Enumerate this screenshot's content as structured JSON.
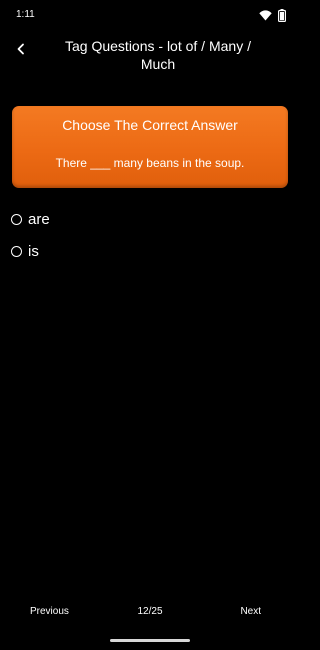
{
  "status_bar": {
    "time": "1:11",
    "icons": [
      "wifi-icon",
      "battery-icon"
    ]
  },
  "app_bar": {
    "back_icon": "chevron-left-icon",
    "title": "Tag Questions - lot of / Many / Much"
  },
  "card": {
    "heading": "Choose The Correct Answer",
    "question": "There ___ many beans in the soup.",
    "color": "#ec6a14"
  },
  "options": [
    {
      "label": "are",
      "selected": false
    },
    {
      "label": "is",
      "selected": false
    }
  ],
  "nav": {
    "previous": "Previous",
    "counter": "12/25",
    "next": "Next"
  }
}
